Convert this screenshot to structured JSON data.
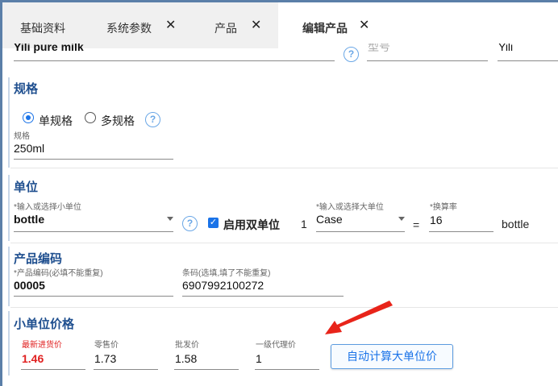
{
  "tabs": [
    {
      "label": "基础资料",
      "closable": false,
      "active": false
    },
    {
      "label": "系统参数",
      "closable": true,
      "active": false
    },
    {
      "label": "产品",
      "closable": true,
      "active": false
    },
    {
      "label": "编辑产品",
      "closable": true,
      "active": true
    }
  ],
  "close_glyph": "✕",
  "top_row": {
    "name_value": "Yili pure milk",
    "model_placeholder": "型号",
    "brand_value": "Yili"
  },
  "spec": {
    "section_title": "规格",
    "single_label": "单规格",
    "multi_label": "多规格",
    "selected": "single",
    "field_label": "规格",
    "field_value": "250ml"
  },
  "unit": {
    "section_title": "单位",
    "small_label": "*输入或选择小单位",
    "small_value": "bottle",
    "dual_checked": true,
    "dual_label": "启用双单位",
    "one": "1",
    "large_label": "*输入或选择大单位",
    "large_value": "Case",
    "equals": "=",
    "rate_label": "*换算率",
    "rate_value": "16",
    "rate_unit": "bottle"
  },
  "code": {
    "section_title": "产品编码",
    "code_label": "*产品编码(必填不能重复)",
    "code_value": "00005",
    "barcode_label": "条码(选填,填了不能重复)",
    "barcode_value": "6907992100272"
  },
  "price": {
    "section_title": "小单位价格",
    "latest_label": "最新进货价",
    "latest_value": "1.46",
    "retail_label": "零售价",
    "retail_value": "1.73",
    "wholesale_label": "批发价",
    "wholesale_value": "1.58",
    "agent_label": "一级代理价",
    "agent_value": "1",
    "calc_button": "自动计算大单位价"
  },
  "help_glyph": "?",
  "colors": {
    "accent": "#1a73e8",
    "section": "#1f4f8f",
    "highlight_red": "#e02020",
    "annotation_arrow": "#e8241a"
  }
}
